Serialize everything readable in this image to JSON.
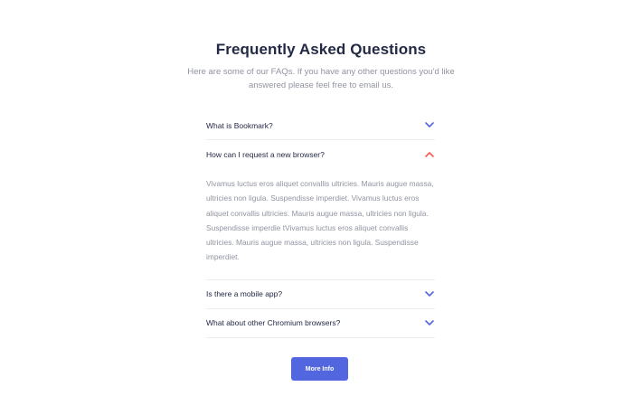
{
  "faq": {
    "title": "Frequently Asked Questions",
    "subtitle": "Here are some of our FAQs. If you have any other questions you'd like answered please feel free to email us.",
    "items": [
      {
        "question": "What is Bookmark?",
        "expanded": false,
        "icon": "chevron-down-icon"
      },
      {
        "question": "How can I request a new browser?",
        "expanded": true,
        "icon": "chevron-up-icon",
        "answer": "Vivamus luctus eros aliquet convallis ultricies. Mauris augue massa, ultricies non ligula. Suspendisse imperdiet. Vivamus luctus eros aliquet convallis ultricies. Mauris augue massa, ultricies non ligula. Suspendisse imperdie tVivamus luctus eros aliquet convallis ultricies. Mauris augue massa, ultricies non ligula. Suspendisse imperdiet."
      },
      {
        "question": "Is there a mobile app?",
        "expanded": false,
        "icon": "chevron-down-icon"
      },
      {
        "question": "What about other Chromium browsers?",
        "expanded": false,
        "icon": "chevron-down-icon"
      }
    ],
    "button_label": "More Info"
  },
  "colors": {
    "heading": "#242a45",
    "muted_text": "#9194a1",
    "chevron_closed": "#5267df",
    "chevron_open": "#fa5757",
    "button_bg": "#5267df",
    "divider": "#ececee"
  }
}
